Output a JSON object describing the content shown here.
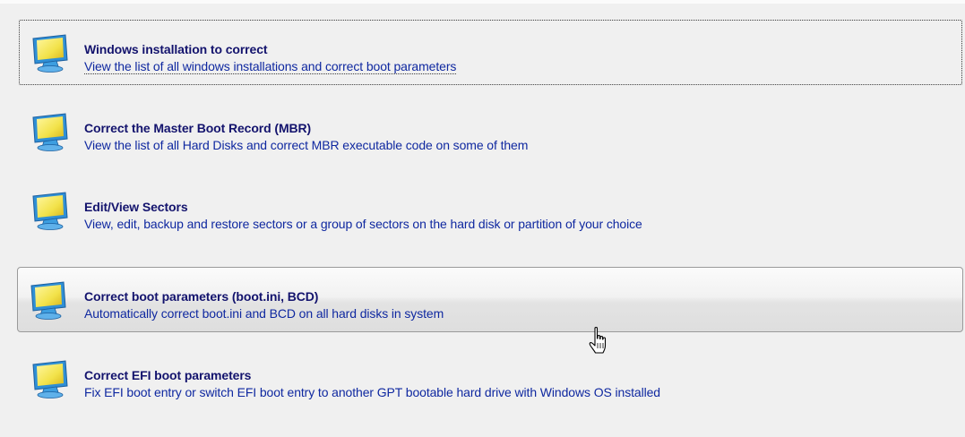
{
  "items": [
    {
      "title": "Windows installation to correct",
      "description": "View the list of all windows installations and correct boot parameters",
      "icon": "monitor-icon",
      "state": "focused"
    },
    {
      "title": "Correct the Master Boot Record (MBR)",
      "description": "View the list of all Hard Disks and correct MBR executable code on some of them",
      "icon": "monitor-icon",
      "state": "normal"
    },
    {
      "title": "Edit/View Sectors",
      "description": "View, edit, backup and restore sectors or a group of sectors on the hard disk or partition of your choice",
      "icon": "monitor-icon",
      "state": "normal"
    },
    {
      "title": "Correct boot parameters (boot.ini, BCD)",
      "description": "Automatically correct boot.ini and BCD on all hard disks in system",
      "icon": "monitor-icon",
      "state": "hovered"
    },
    {
      "title": "Correct EFI boot parameters",
      "description": "Fix EFI boot entry or switch EFI boot entry to another GPT bootable hard drive with Windows OS installed",
      "icon": "monitor-icon",
      "state": "normal"
    }
  ],
  "colors": {
    "background": "#f0f0f0",
    "title": "#13136d",
    "description": "#0f28a0",
    "monitor_frame": "#2f8fd6",
    "monitor_screen": "#f2e24a"
  },
  "cursor_icon": "hand-pointer-icon"
}
